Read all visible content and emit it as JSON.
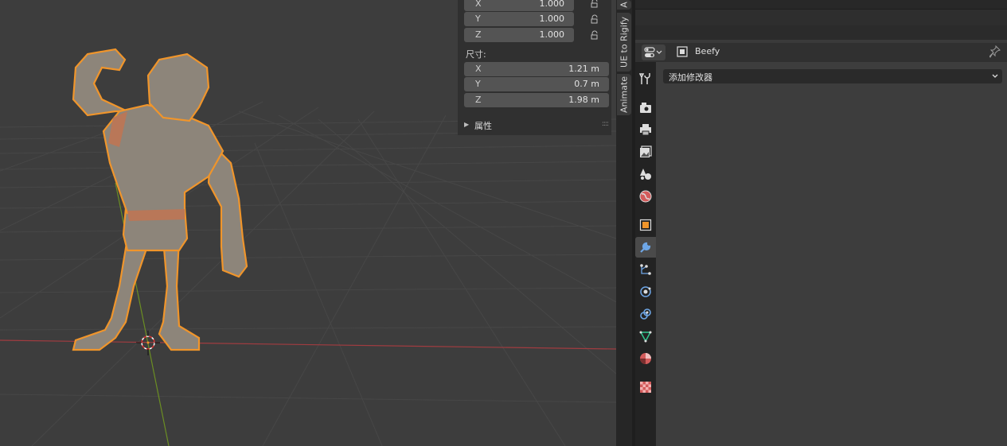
{
  "scale": {
    "rows": [
      {
        "label": "X",
        "value": "1.000"
      },
      {
        "label": "Y",
        "value": "1.000"
      },
      {
        "label": "Z",
        "value": "1.000"
      }
    ]
  },
  "dimensions": {
    "title": "尺寸:",
    "rows": [
      {
        "label": "X",
        "value": "1.21 m"
      },
      {
        "label": "Y",
        "value": "0.7 m"
      },
      {
        "label": "Z",
        "value": "1.98 m"
      }
    ]
  },
  "properties_panel": {
    "label": "属性"
  },
  "side_tabs": [
    {
      "label": "A"
    },
    {
      "label": "UE to Rigify"
    },
    {
      "label": "Animate"
    }
  ],
  "properties_header": {
    "object_name": "Beefy"
  },
  "modifier": {
    "add_label": "添加修改器"
  },
  "property_tabs": [
    {
      "name": "tool-tab",
      "icon": "wrench-screwdriver-icon"
    },
    {
      "name": "render-tab",
      "icon": "camera-back-icon"
    },
    {
      "name": "output-tab",
      "icon": "printer-icon"
    },
    {
      "name": "view-layer-tab",
      "icon": "image-stack-icon"
    },
    {
      "name": "scene-tab",
      "icon": "cone-sphere-icon"
    },
    {
      "name": "world-tab",
      "icon": "globe-icon"
    },
    {
      "name": "object-tab",
      "icon": "orange-square-icon"
    },
    {
      "name": "modifier-tab",
      "icon": "wrench-icon",
      "active": true
    },
    {
      "name": "particles-tab",
      "icon": "particles-icon"
    },
    {
      "name": "physics-tab",
      "icon": "orbit-icon"
    },
    {
      "name": "constraints-tab",
      "icon": "constraint-icon"
    },
    {
      "name": "data-tab",
      "icon": "triangle-mesh-icon"
    },
    {
      "name": "material-tab",
      "icon": "material-sphere-icon"
    },
    {
      "name": "texture-tab",
      "icon": "checker-icon"
    }
  ],
  "colors": {
    "accent_blue": "#4f8fd6",
    "selection_outline": "#f0952b",
    "x_axis": "#a13c40",
    "y_axis": "#6b8e23",
    "mesh_tint": "#8d857a"
  }
}
